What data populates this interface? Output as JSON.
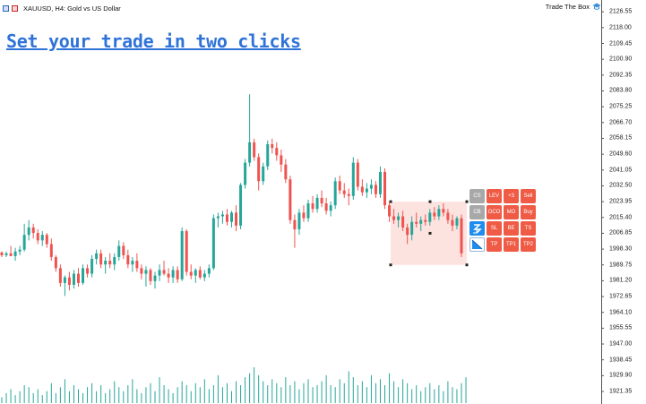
{
  "window": {
    "title": "XAUUSD, H4:  Gold vs US Dollar",
    "brand": "Trade The Box"
  },
  "headline": "Set your trade in two clicks",
  "price_axis": {
    "labels": [
      "2126.55",
      "2118.00",
      "2109.45",
      "2100.90",
      "2092.35",
      "2083.80",
      "2075.25",
      "2066.70",
      "2058.15",
      "2049.60",
      "2041.05",
      "2032.50",
      "2023.95",
      "2015.40",
      "2006.85",
      "1998.30",
      "1989.75",
      "1981.20",
      "1972.65",
      "1964.10",
      "1955.55",
      "1947.00",
      "1938.45",
      "1929.90",
      "1921.35"
    ]
  },
  "trade_panel": {
    "rows": [
      [
        {
          "label": "CS",
          "style": "gray"
        },
        {
          "label": "LEV",
          "style": "red"
        },
        {
          "label": "+3",
          "style": "red"
        },
        {
          "label": "Sell",
          "style": "red"
        }
      ],
      [
        {
          "label": "CB",
          "style": "gray"
        },
        {
          "label": "OCO",
          "style": "red"
        },
        {
          "label": "MO",
          "style": "red"
        },
        {
          "label": "Buy",
          "style": "red"
        }
      ],
      [
        {
          "label": "",
          "icon": "lightning-icon",
          "style": "blue"
        },
        {
          "label": "SL",
          "style": "red"
        },
        {
          "label": "BE",
          "style": "red"
        },
        {
          "label": "TS",
          "style": "red"
        }
      ],
      [
        {
          "label": "",
          "icon": "diagonal-line-icon",
          "style": "white"
        },
        {
          "label": "TP",
          "style": "red"
        },
        {
          "label": "TP1",
          "style": "red"
        },
        {
          "label": "TP2",
          "style": "red"
        }
      ]
    ]
  },
  "colors": {
    "bull": "#26a69a",
    "bear": "#ef5350",
    "box_fill": "#fde3df",
    "panel_red": "#ef5b45",
    "panel_gray": "#a8a8a8",
    "panel_blue": "#1f8ded",
    "headline": "#2f73d9"
  },
  "chart_data": {
    "type": "candlestick",
    "symbol": "XAUUSD",
    "timeframe": "H4",
    "y_range": [
      1917.0,
      2131.0
    ],
    "candles": [
      [
        1996.5,
        1997.0,
        1994.0,
        1995.0
      ],
      [
        1995.0,
        1997.0,
        1994.0,
        1996.0
      ],
      [
        1996.0,
        2000.0,
        1995.0,
        1994.5
      ],
      [
        1994.5,
        1999.0,
        1992.0,
        1997.0
      ],
      [
        1997.0,
        2000.0,
        1995.0,
        1998.0
      ],
      [
        1998.0,
        2012.0,
        1997.0,
        2006.0
      ],
      [
        2006.0,
        2014.0,
        2003.0,
        2010.0
      ],
      [
        2010.0,
        2012.0,
        2004.0,
        2007.0
      ],
      [
        2007.0,
        2009.0,
        2001.0,
        2003.0
      ],
      [
        2003.0,
        2008.0,
        2000.0,
        2006.0
      ],
      [
        2006.0,
        2007.0,
        1999.0,
        2001.0
      ],
      [
        2001.0,
        2004.0,
        1992.0,
        1994.0
      ],
      [
        1994.0,
        1995.0,
        1986.0,
        1988.0
      ],
      [
        1988.0,
        1990.0,
        1978.0,
        1980.0
      ],
      [
        1980.0,
        1984.0,
        1973.0,
        1983.0
      ],
      [
        1983.0,
        1986.0,
        1976.0,
        1979.0
      ],
      [
        1979.0,
        1987.0,
        1977.0,
        1985.0
      ],
      [
        1985.0,
        1988.0,
        1978.0,
        1980.0
      ],
      [
        1980.0,
        1990.0,
        1979.0,
        1988.0
      ],
      [
        1988.0,
        1990.0,
        1983.0,
        1985.0
      ],
      [
        1985.0,
        1995.0,
        1983.0,
        1993.0
      ],
      [
        1993.0,
        1998.0,
        1990.0,
        1996.0
      ],
      [
        1996.0,
        1998.0,
        1988.0,
        1990.0
      ],
      [
        1990.0,
        1994.0,
        1985.0,
        1992.0
      ],
      [
        1992.0,
        1996.0,
        1988.0,
        1990.0
      ],
      [
        1990.0,
        1996.0,
        1987.0,
        1994.0
      ],
      [
        1994.0,
        2003.0,
        1992.0,
        2000.0
      ],
      [
        2000.0,
        2002.0,
        1993.0,
        1995.0
      ],
      [
        1995.0,
        1998.0,
        1988.0,
        1990.0
      ],
      [
        1990.0,
        1994.0,
        1986.0,
        1992.0
      ],
      [
        1992.0,
        1996.0,
        1986.0,
        1988.0
      ],
      [
        1988.0,
        1990.0,
        1982.0,
        1985.0
      ],
      [
        1985.0,
        1989.0,
        1978.0,
        1987.0
      ],
      [
        1987.0,
        1988.0,
        1979.0,
        1981.0
      ],
      [
        1981.0,
        1986.0,
        1977.0,
        1984.0
      ],
      [
        1984.0,
        1990.0,
        1981.0,
        1987.0
      ],
      [
        1987.0,
        1992.0,
        1984.0,
        1985.0
      ],
      [
        1985.0,
        1988.0,
        1980.0,
        1983.0
      ],
      [
        1983.0,
        1989.0,
        1980.0,
        1987.0
      ],
      [
        1987.0,
        1989.0,
        1980.0,
        1982.0
      ],
      [
        1982.0,
        2010.0,
        1981.0,
        2008.0
      ],
      [
        2008.0,
        2009.0,
        1984.0,
        1986.0
      ],
      [
        1986.0,
        1990.0,
        1982.0,
        1984.0
      ],
      [
        1984.0,
        1988.0,
        1980.0,
        1987.0
      ],
      [
        1987.0,
        1989.0,
        1982.0,
        1983.0
      ],
      [
        1983.0,
        1987.0,
        1981.0,
        1985.0
      ],
      [
        1985.0,
        1990.0,
        1983.0,
        1988.0
      ],
      [
        1988.0,
        2017.0,
        1987.0,
        2015.0
      ],
      [
        2015.0,
        2018.0,
        2010.0,
        2016.0
      ],
      [
        2016.0,
        2019.0,
        2012.0,
        2017.0
      ],
      [
        2017.0,
        2020.0,
        2011.0,
        2013.0
      ],
      [
        2013.0,
        2019.0,
        2010.0,
        2018.0
      ],
      [
        2018.0,
        2022.0,
        2008.0,
        2011.0
      ],
      [
        2011.0,
        2034.0,
        2009.0,
        2033.0
      ],
      [
        2033.0,
        2047.0,
        2031.0,
        2045.0
      ],
      [
        2045.0,
        2082.0,
        2043.0,
        2056.0
      ],
      [
        2056.0,
        2058.0,
        2046.0,
        2048.0
      ],
      [
        2048.0,
        2050.0,
        2030.0,
        2035.0
      ],
      [
        2035.0,
        2045.0,
        2033.0,
        2043.0
      ],
      [
        2043.0,
        2057.0,
        2041.0,
        2055.0
      ],
      [
        2055.0,
        2058.0,
        2050.0,
        2053.0
      ],
      [
        2053.0,
        2056.0,
        2046.0,
        2049.0
      ],
      [
        2049.0,
        2052.0,
        2040.0,
        2044.0
      ],
      [
        2044.0,
        2047.0,
        2034.0,
        2036.0
      ],
      [
        2036.0,
        2038.0,
        2012.0,
        2014.0
      ],
      [
        2014.0,
        2017.0,
        1999.0,
        2009.0
      ],
      [
        2009.0,
        2020.0,
        2006.0,
        2018.0
      ],
      [
        2018.0,
        2022.0,
        2013.0,
        2015.0
      ],
      [
        2015.0,
        2025.0,
        2013.0,
        2023.0
      ],
      [
        2023.0,
        2027.0,
        2018.0,
        2020.0
      ],
      [
        2020.0,
        2028.0,
        2018.0,
        2026.0
      ],
      [
        2026.0,
        2030.0,
        2021.0,
        2023.0
      ],
      [
        2023.0,
        2026.0,
        2017.0,
        2019.0
      ],
      [
        2019.0,
        2024.0,
        2016.0,
        2022.0
      ],
      [
        2022.0,
        2037.0,
        2020.0,
        2035.0
      ],
      [
        2035.0,
        2038.0,
        2028.0,
        2030.0
      ],
      [
        2030.0,
        2034.0,
        2026.0,
        2028.0
      ],
      [
        2028.0,
        2031.0,
        2022.0,
        2027.0
      ],
      [
        2027.0,
        2048.0,
        2025.0,
        2045.0
      ],
      [
        2045.0,
        2047.0,
        2030.0,
        2032.0
      ],
      [
        2032.0,
        2036.0,
        2027.0,
        2029.0
      ],
      [
        2029.0,
        2034.0,
        2026.0,
        2031.0
      ],
      [
        2031.0,
        2036.0,
        2028.0,
        2033.0
      ],
      [
        2033.0,
        2035.0,
        2026.0,
        2028.0
      ],
      [
        2028.0,
        2043.0,
        2026.0,
        2040.0
      ],
      [
        2040.0,
        2042.0,
        2020.0,
        2022.0
      ],
      [
        2022.0,
        2024.0,
        2013.0,
        2016.0
      ],
      [
        2016.0,
        2020.0,
        2012.0,
        2014.0
      ],
      [
        2014.0,
        2018.0,
        2010.0,
        2016.0
      ],
      [
        2016.0,
        2019.0,
        2008.0,
        2010.0
      ],
      [
        2010.0,
        2012.0,
        2001.0,
        2006.0
      ],
      [
        2006.0,
        2016.0,
        2003.0,
        2013.0
      ],
      [
        2013.0,
        2018.0,
        2010.0,
        2012.0
      ],
      [
        2012.0,
        2016.0,
        2008.0,
        2014.0
      ],
      [
        2014.0,
        2017.0,
        2011.0,
        2013.0
      ],
      [
        2013.0,
        2020.0,
        2011.0,
        2018.0
      ],
      [
        2018.0,
        2021.0,
        2014.0,
        2016.0
      ],
      [
        2016.0,
        2022.0,
        2014.0,
        2020.0
      ],
      [
        2020.0,
        2023.0,
        2016.0,
        2018.0
      ],
      [
        2018.0,
        2020.0,
        2012.0,
        2014.0
      ],
      [
        2014.0,
        2017.0,
        2008.0,
        2011.0
      ],
      [
        2011.0,
        2016.0,
        2009.0,
        2015.0
      ],
      [
        2015.0,
        2017.0,
        1994.0,
        1996.0
      ]
    ],
    "volumes": [
      3,
      5,
      7,
      4,
      6,
      9,
      8,
      5,
      7,
      4,
      6,
      10,
      5,
      8,
      12,
      6,
      9,
      7,
      5,
      8,
      10,
      6,
      9,
      5,
      7,
      11,
      8,
      6,
      9,
      12,
      7,
      5,
      8,
      10,
      6,
      13,
      9,
      7,
      5,
      8,
      11,
      9,
      6,
      10,
      8,
      12,
      7,
      9,
      14,
      8,
      10,
      6,
      11,
      9,
      13,
      15,
      18,
      14,
      11,
      9,
      12,
      10,
      8,
      13,
      9,
      11,
      7,
      10,
      12,
      8,
      9,
      11,
      14,
      9,
      8,
      12,
      10,
      16,
      13,
      9,
      11,
      8,
      14,
      10,
      12,
      9,
      15,
      11,
      8,
      12,
      10,
      7,
      9,
      6,
      8,
      10,
      7,
      9,
      6,
      11,
      8,
      7,
      10,
      13
    ]
  }
}
